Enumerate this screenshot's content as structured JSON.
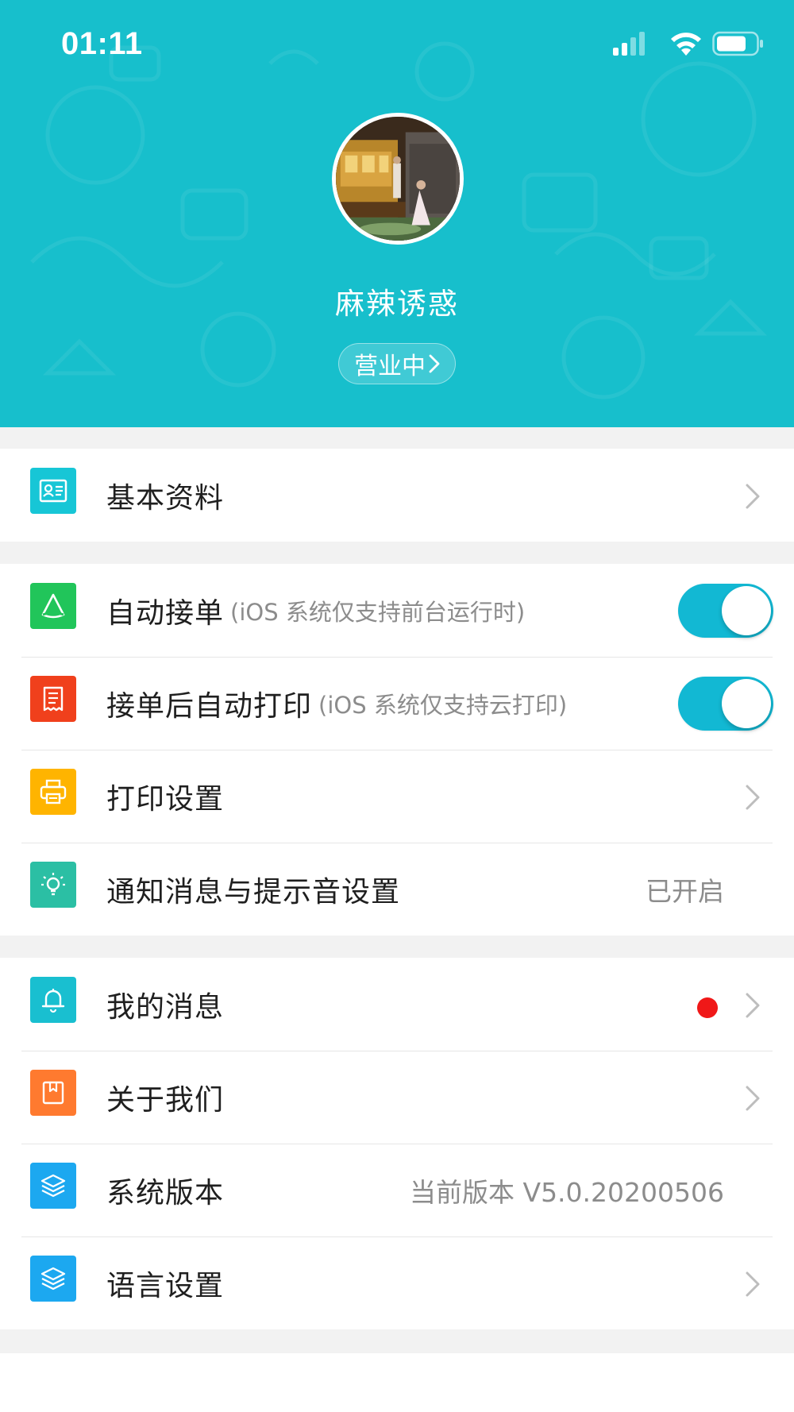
{
  "status_bar": {
    "time": "01:11",
    "icons": [
      "cellular-signal-icon",
      "wifi-icon",
      "battery-icon"
    ]
  },
  "profile": {
    "shop_name": "麻辣诱惑",
    "business_status": "营业中",
    "header_color": "#17bfcc"
  },
  "sections": {
    "basic_info": {
      "label": "基本资料",
      "icon": "id-card-icon",
      "icon_color": "#17c6d6"
    },
    "auto_accept": {
      "label": "自动接单",
      "hint": "(iOS 系统仅支持前台运行时)",
      "icon": "accept-order-icon",
      "icon_color": "#21c55a",
      "toggle_on": true
    },
    "auto_print": {
      "label": "接单后自动打印",
      "hint": "(iOS 系统仅支持云打印)",
      "icon": "receipt-icon",
      "icon_color": "#f0401c",
      "toggle_on": true
    },
    "print_settings": {
      "label": "打印设置",
      "icon": "printer-icon",
      "icon_color": "#ffb400"
    },
    "notification_settings": {
      "label": "通知消息与提示音设置",
      "value": "已开启",
      "icon": "lightbulb-icon",
      "icon_color": "#2bbfa4"
    },
    "my_messages": {
      "label": "我的消息",
      "icon": "bell-icon",
      "icon_color": "#19bfd0",
      "unread": true,
      "unread_color": "#f01818"
    },
    "about_us": {
      "label": "关于我们",
      "icon": "bookmark-icon",
      "icon_color": "#ff7a2f"
    },
    "system_version": {
      "label": "系统版本",
      "value": "当前版本 V5.0.20200506",
      "icon": "layers-icon",
      "icon_color": "#1ca8f0"
    },
    "language_settings": {
      "label": "语言设置",
      "icon": "layers-icon",
      "icon_color": "#1ca8f0"
    }
  },
  "colors": {
    "accent": "#12b8d3",
    "background": "#f2f2f2"
  }
}
